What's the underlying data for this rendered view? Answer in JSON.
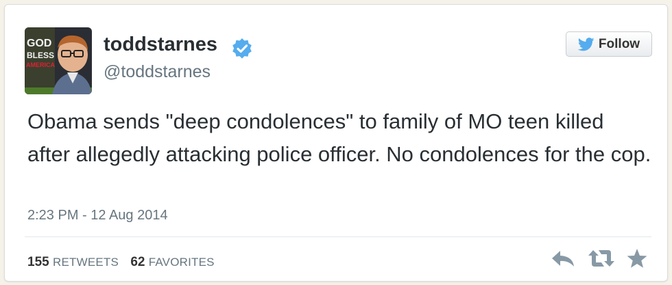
{
  "tweet": {
    "display_name": "toddstarnes",
    "handle": "@toddstarnes",
    "text": "Obama sends \"deep condolences\" to family of MO teen killed after allegedly attacking police officer. No condolences for the cop.",
    "timestamp": "2:23 PM - 12 Aug 2014",
    "retweets_count": "155",
    "retweets_label": "RETWEETS",
    "favorites_count": "62",
    "favorites_label": "FAVORITES"
  },
  "follow_button": {
    "label": "Follow"
  },
  "avatar": {
    "book_title_lines": [
      "GOD",
      "BLESS",
      "AMERICA"
    ]
  },
  "icons": {
    "verified": "verified-badge-icon",
    "bird": "twitter-bird-icon",
    "reply": "reply-icon",
    "retweet": "retweet-icon",
    "favorite": "star-icon"
  },
  "colors": {
    "verified_blue": "#55acee",
    "twitter_blue": "#55acee",
    "text": "#292f33",
    "muted": "#66757f",
    "action_gray": "#8899a6"
  }
}
